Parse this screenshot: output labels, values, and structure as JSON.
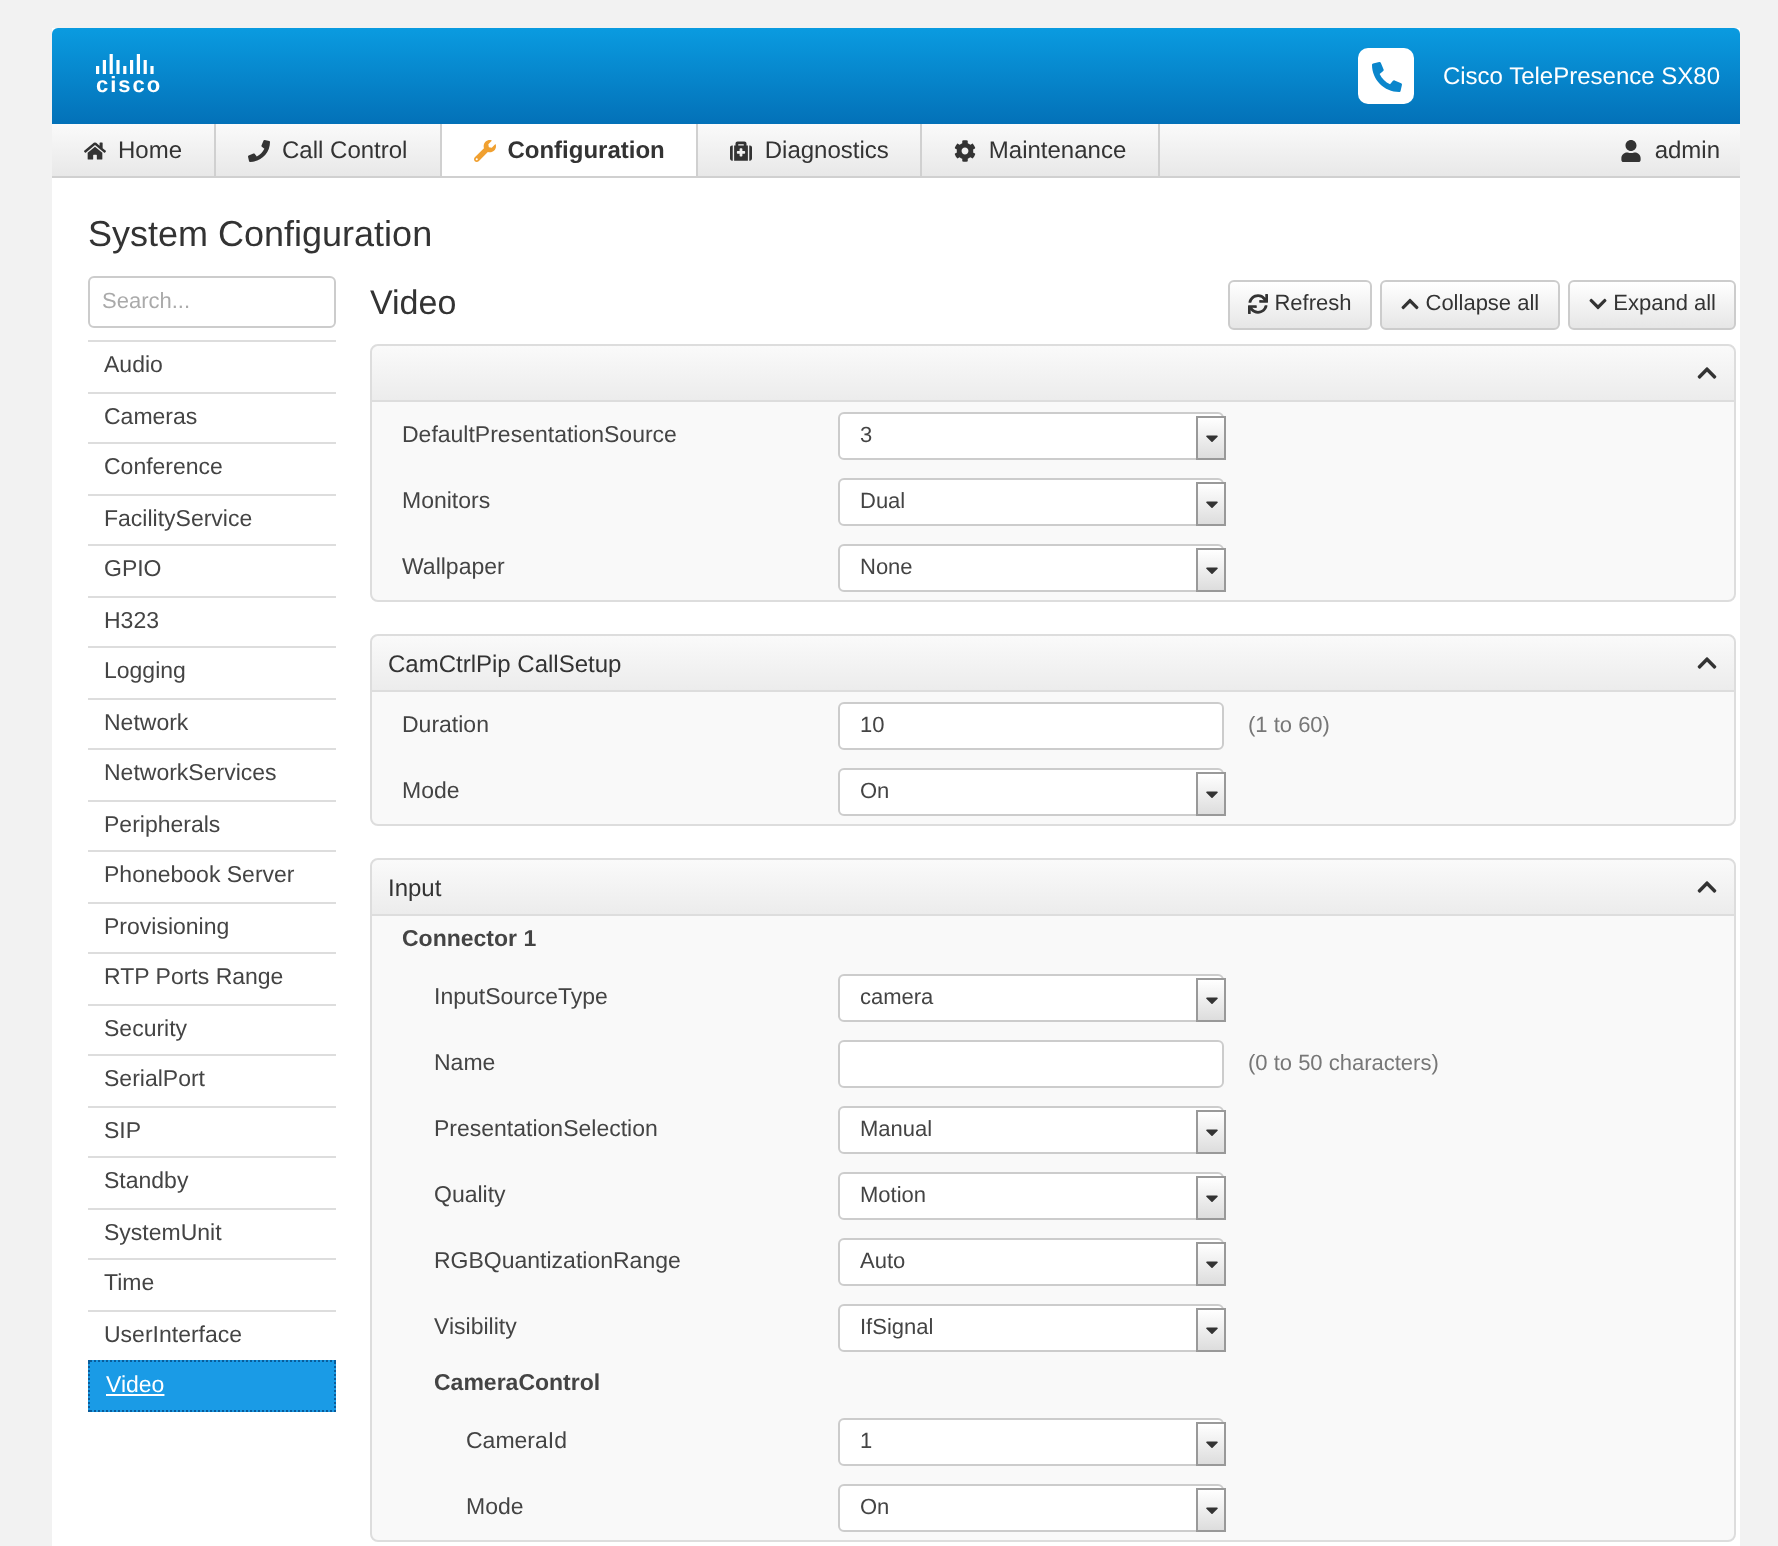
{
  "header": {
    "logo": "cisco",
    "product": "Cisco TelePresence SX80"
  },
  "nav": {
    "tabs": [
      {
        "label": "Home",
        "selected": false
      },
      {
        "label": "Call Control",
        "selected": false
      },
      {
        "label": "Configuration",
        "selected": true
      },
      {
        "label": "Diagnostics",
        "selected": false
      },
      {
        "label": "Maintenance",
        "selected": false
      }
    ],
    "user": "admin"
  },
  "page_title": "System Configuration",
  "sidebar": {
    "search": {
      "placeholder": "Search..."
    },
    "items": [
      {
        "label": "Audio",
        "selected": false
      },
      {
        "label": "Cameras",
        "selected": false
      },
      {
        "label": "Conference",
        "selected": false
      },
      {
        "label": "FacilityService",
        "selected": false
      },
      {
        "label": "GPIO",
        "selected": false
      },
      {
        "label": "H323",
        "selected": false
      },
      {
        "label": "Logging",
        "selected": false
      },
      {
        "label": "Network",
        "selected": false
      },
      {
        "label": "NetworkServices",
        "selected": false
      },
      {
        "label": "Peripherals",
        "selected": false
      },
      {
        "label": "Phonebook Server",
        "selected": false
      },
      {
        "label": "Provisioning",
        "selected": false
      },
      {
        "label": "RTP Ports Range",
        "selected": false
      },
      {
        "label": "Security",
        "selected": false
      },
      {
        "label": "SerialPort",
        "selected": false
      },
      {
        "label": "SIP",
        "selected": false
      },
      {
        "label": "Standby",
        "selected": false
      },
      {
        "label": "SystemUnit",
        "selected": false
      },
      {
        "label": "Time",
        "selected": false
      },
      {
        "label": "UserInterface",
        "selected": false
      },
      {
        "label": "Video",
        "selected": true
      }
    ]
  },
  "main": {
    "title": "Video",
    "buttons": [
      {
        "label": "Refresh"
      },
      {
        "label": "Collapse all"
      },
      {
        "label": "Expand all"
      }
    ],
    "sections": [
      {
        "expanded": true,
        "rows": [
          {
            "kind": "select",
            "label": "DefaultPresentationSource",
            "value": "3"
          },
          {
            "kind": "select",
            "label": "Monitors",
            "value": "Dual"
          },
          {
            "kind": "select",
            "label": "Wallpaper",
            "value": "None"
          }
        ]
      },
      {
        "title": "CamCtrlPip CallSetup",
        "expanded": true,
        "rows": [
          {
            "kind": "text",
            "label": "Duration",
            "value": "10",
            "hint": "(1 to 60)"
          },
          {
            "kind": "select",
            "label": "Mode",
            "value": "On"
          }
        ]
      },
      {
        "title": "Input",
        "expanded": true,
        "rows": [
          {
            "kind": "heading",
            "label": "Connector 1",
            "children": [
              {
                "kind": "select",
                "label": "InputSourceType",
                "value": "camera"
              },
              {
                "kind": "text",
                "label": "Name",
                "hint": "(0 to 50 characters)"
              },
              {
                "kind": "select",
                "label": "PresentationSelection",
                "value": "Manual"
              },
              {
                "kind": "select",
                "label": "Quality",
                "value": "Motion"
              },
              {
                "kind": "select",
                "label": "RGBQuantizationRange",
                "value": "Auto"
              },
              {
                "kind": "select",
                "label": "Visibility",
                "value": "IfSignal"
              },
              {
                "kind": "heading",
                "label": "CameraControl",
                "children": [
                  {
                    "kind": "select",
                    "label": "CameraId",
                    "value": "1"
                  },
                  {
                    "kind": "select",
                    "label": "Mode",
                    "value": "On"
                  }
                ]
              }
            ]
          }
        ]
      }
    ]
  }
}
